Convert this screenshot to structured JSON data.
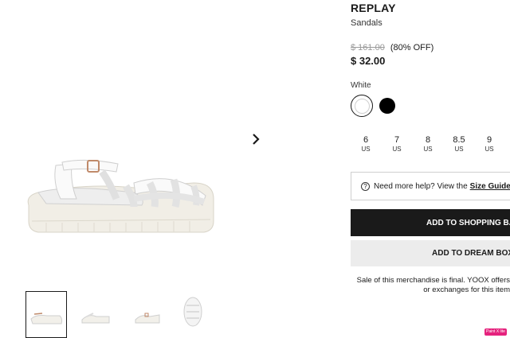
{
  "product": {
    "brand": "REPLAY",
    "category": "Sandals",
    "original_price": "$ 161.00",
    "discount": "(80% OFF)",
    "price": "$ 32.00",
    "color_label": "White",
    "colors": [
      {
        "name": "White",
        "hex": "#ffffff",
        "selected": true
      },
      {
        "name": "Black",
        "hex": "#000000",
        "selected": false
      }
    ]
  },
  "sizes": [
    {
      "num": "6",
      "unit": "US"
    },
    {
      "num": "7",
      "unit": "US"
    },
    {
      "num": "8",
      "unit": "US"
    },
    {
      "num": "8.5",
      "unit": "US"
    },
    {
      "num": "9",
      "unit": "US"
    }
  ],
  "help": {
    "text": "Need more help? View the",
    "link": "Size Guide"
  },
  "buttons": {
    "add_to_bag": "ADD TO SHOPPING BAG",
    "add_to_dream_box": "ADD TO DREAM BOX"
  },
  "final_note": {
    "line1": "Sale of this merchandise is final. YOOX offers",
    "line2": "or exchanges for this item"
  },
  "badge": "Paint X lite",
  "icons": {
    "next": "chevron-right-icon",
    "help": "question-circle-icon"
  },
  "colors": {
    "primary_button": "#1a1a1a",
    "secondary_button": "#ececec",
    "badge": "#e5227d"
  }
}
